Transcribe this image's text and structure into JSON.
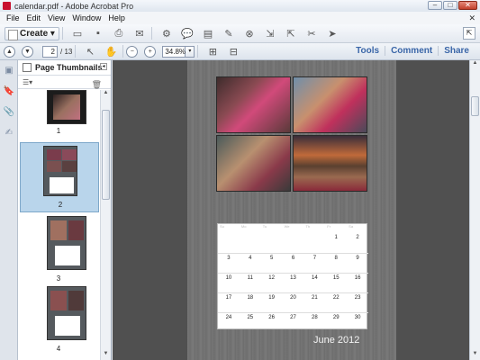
{
  "window": {
    "title": "calendar.pdf - Adobe Acrobat Pro",
    "minimize": "–",
    "maximize": "□",
    "close": "✕"
  },
  "menu": {
    "items": [
      "File",
      "Edit",
      "View",
      "Window",
      "Help"
    ],
    "close": "✕"
  },
  "toolbar": {
    "create_label": "Create",
    "create_arrow": "▾"
  },
  "nav": {
    "prev_icon": "▲",
    "next_icon": "▼",
    "current_page": "2",
    "total_pages": "/ 13",
    "zoom_value": "34.8%",
    "zoom_drop": "▾",
    "zoom_out": "−",
    "zoom_in": "+"
  },
  "right_links": [
    "Tools",
    "Comment",
    "Share"
  ],
  "sidebar": {
    "panel_title": "Page Thumbnails",
    "options_icon": "☰▾",
    "trash_icon": "🗑",
    "thumbnails": [
      {
        "label": "1"
      },
      {
        "label": "2"
      },
      {
        "label": "3"
      },
      {
        "label": "4"
      }
    ]
  },
  "calendar": {
    "title": "June  2012",
    "days_of_week": [
      "Su",
      "Mo",
      "Tu",
      "We",
      "Th",
      "Fr",
      "Sa"
    ],
    "rows": [
      [
        "",
        "",
        "",
        "",
        "",
        "1",
        "2"
      ],
      [
        "3",
        "4",
        "5",
        "6",
        "7",
        "8",
        "9"
      ],
      [
        "10",
        "11",
        "12",
        "13",
        "14",
        "15",
        "16"
      ],
      [
        "17",
        "18",
        "19",
        "20",
        "21",
        "22",
        "23"
      ],
      [
        "24",
        "25",
        "26",
        "27",
        "28",
        "29",
        "30"
      ]
    ]
  }
}
